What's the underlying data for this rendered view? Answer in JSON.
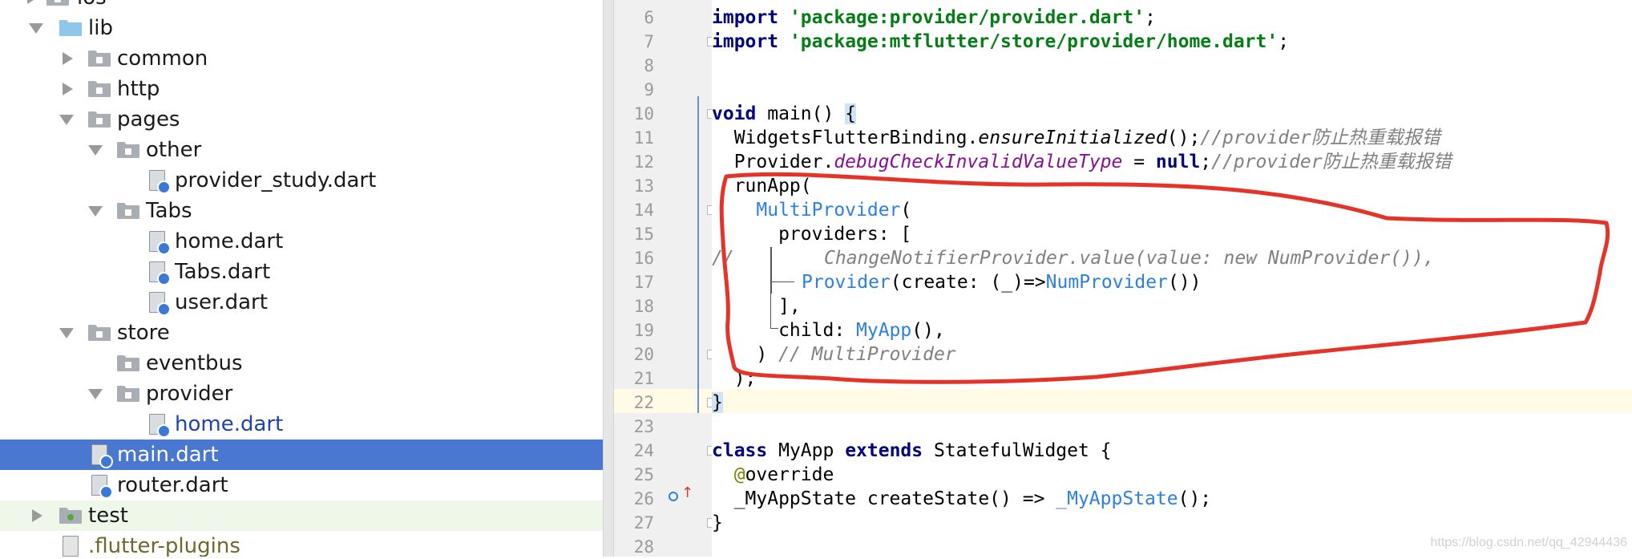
{
  "tree": {
    "items": [
      {
        "label": "ios"
      },
      {
        "label": "lib"
      },
      {
        "label": "common"
      },
      {
        "label": "http"
      },
      {
        "label": "pages"
      },
      {
        "label": "other"
      },
      {
        "label": "provider_study.dart"
      },
      {
        "label": "Tabs"
      },
      {
        "label": "home.dart"
      },
      {
        "label": "Tabs.dart"
      },
      {
        "label": "user.dart"
      },
      {
        "label": "store"
      },
      {
        "label": "eventbus"
      },
      {
        "label": "provider"
      },
      {
        "label": "home.dart"
      },
      {
        "label": "main.dart"
      },
      {
        "label": "router.dart"
      },
      {
        "label": "test"
      },
      {
        "label": ".flutter-plugins"
      }
    ]
  },
  "editor": {
    "line_numbers": [
      "6",
      "7",
      "8",
      "9",
      "10",
      "11",
      "12",
      "13",
      "14",
      "15",
      "16",
      "17",
      "18",
      "19",
      "20",
      "21",
      "22",
      "23",
      "24",
      "25",
      "26",
      "27",
      "28"
    ],
    "lines": {
      "l6": {
        "kw": "import",
        "str": "'package:provider/provider.dart'",
        "end": ";"
      },
      "l7": {
        "kw": "import",
        "str": "'package:mtflutter/store/provider/home.dart'",
        "end": ";"
      },
      "l10": {
        "kw": "void",
        "rest": " main() ",
        "brace": "{"
      },
      "l11": {
        "pre": "  WidgetsFlutterBinding.",
        "method": "ensureInitialized",
        "mid": "();",
        "comment": "//provider防止热重载报错"
      },
      "l12": {
        "pre": "  Provider.",
        "field": "debugCheckInvalidValueType",
        "mid": " = ",
        "kw": "null",
        "end": ";",
        "comment": "//provider防止热重载报错"
      },
      "l13": {
        "text": "  runApp("
      },
      "l14": {
        "indent": "    ",
        "cls": "MultiProvider",
        "end": "("
      },
      "l15": {
        "text": "      providers: ["
      },
      "l16": {
        "prefix": "//",
        "comment": "ChangeNotifierProvider.value(value: new NumProvider()),"
      },
      "l17": {
        "cls": "Provider",
        "mid": "(create: (_)=>",
        "cls2": "NumProvider",
        "end": "())"
      },
      "l18": {
        "text": "      ],"
      },
      "l19": {
        "pre": "      child: ",
        "cls": "MyApp",
        "end": "(),"
      },
      "l20": {
        "pre": "    ) ",
        "comment": "// MultiProvider"
      },
      "l21": {
        "text": "  );"
      },
      "l22": {
        "brace": "}"
      },
      "l24": {
        "kw": "class",
        "mid": " MyApp ",
        "kw2": "extends",
        "end": " StatefulWidget {"
      },
      "l25": {
        "ann": "@",
        "rest": "override"
      },
      "l26": {
        "pre": "  _MyAppState createState() => ",
        "cls": "_MyAppState",
        "end": "();"
      },
      "l27": {
        "text": "}"
      }
    }
  },
  "watermark": "https://blog.csdn.net/qq_42944436",
  "colors": {
    "selection": "#4a78d0",
    "annotation_circle": "#e5332a",
    "keyword": "#000080",
    "string": "#067d17",
    "class_ref": "#2d7fe0"
  }
}
